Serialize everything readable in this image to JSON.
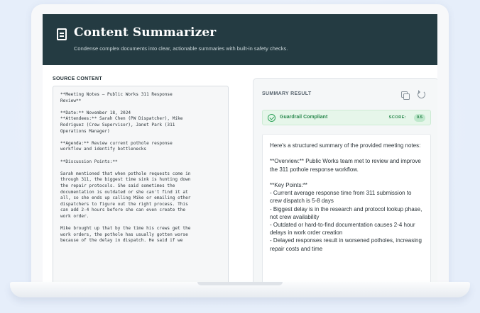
{
  "app": {
    "title": "Content Summarizer",
    "subtitle": "Condense complex documents into clear, actionable summaries with built-in safety checks."
  },
  "source": {
    "label": "SOURCE CONTENT",
    "text": "**Meeting Notes – Public Works 311 Response\nReview**\n\n**Date:** November 18, 2024\n**Attendees:** Sarah Chen (PW Dispatcher), Mike\nRodriguez (Crew Supervisor), Janet Park (311\nOperations Manager)\n\n**Agenda:** Review current pothole response\nworkflow and identify bottlenecks\n\n**Discussion Points:**\n\nSarah mentioned that when pothole requests come in\nthrough 311, the biggest time sink is hunting down\nthe repair protocols. She said sometimes the\ndocumentation is outdated or she can't find it at\nall, so she ends up calling Mike or emailing other\ndispatchers to figure out the right process. This\ncan add 2-4 hours before she can even create the\nwork order.\n\nMike brought up that by the time his crews get the\nwork orders, the pothole has usually gotten worse\nbecause of the delay in dispatch. He said if we"
  },
  "result": {
    "label": "SUMMARY RESULT",
    "guardrail_text": "Guardrail Compliant",
    "score_label": "SCORE:",
    "score_value": "0.5",
    "summary": "Here's a structured summary of the provided meeting notes:\n\n**Overview:** Public Works team met to review and improve the 311 pothole response workflow.\n\n**Key Points:**\n- Current average response time from 311 submission to crew dispatch is 5-8 days\n- Biggest delay is in the research and protocol lookup phase, not crew availability\n- Outdated or hard-to-find documentation causes 2-4 hour delays in work order creation\n- Delayed responses result in worsened potholes, increasing repair costs and time"
  },
  "icons": {
    "header": "document-icon",
    "copy": "copy-icon",
    "refresh": "refresh-icon",
    "guardrail": "check-circle-icon"
  },
  "colors": {
    "header_bg": "#243b42",
    "success": "#2ea25a",
    "page_bg": "#e9f0fb"
  }
}
